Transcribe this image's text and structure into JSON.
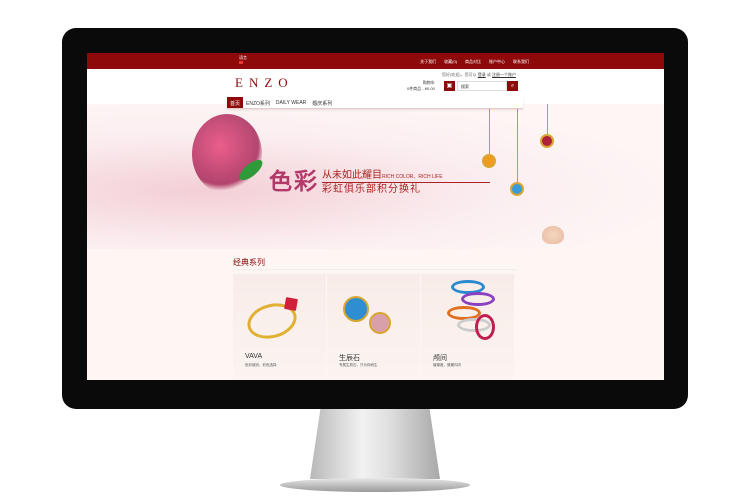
{
  "topbar": {
    "language_label": "语言",
    "links": [
      "关于我们",
      "收藏(0)",
      "商品对比",
      "账户中心",
      "联系我们"
    ]
  },
  "header": {
    "logo": "ENZO",
    "welcome": "您好(欢迎)，您可以",
    "login": "登录",
    "or": "或",
    "register": "注册一个账户",
    "cart_label": "购物车",
    "cart_summary": "0件商品 - ¥0.00",
    "search_placeholder": "搜索"
  },
  "nav": [
    "首页",
    "ENZO系列",
    "DAILY WEAR",
    "婚庆系列"
  ],
  "banner": {
    "title": "色彩",
    "line1": "从未如此耀目",
    "line1_en": "RICH COLOR、RICH LIFE",
    "line2": "彩虹俱乐部积分换礼"
  },
  "section_title": "经典系列",
  "products": [
    {
      "name": "VAVA",
      "desc": "色彩缤纷，彩色选择"
    },
    {
      "name": "生辰石",
      "desc": "专属生辰石，只为你而生"
    },
    {
      "name": "颅间",
      "desc": "璀璨度，微瓏闪闪"
    }
  ]
}
